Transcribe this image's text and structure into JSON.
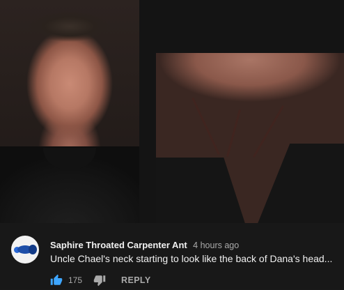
{
  "comment": {
    "author": "Saphire Throated Carpenter Ant",
    "time": "4 hours ago",
    "text": "Uncle Chael's neck starting to look like the back of Dana's head...",
    "like_count": "175",
    "reply_label": "REPLY",
    "avatar_icon": "ant-avatar-icon",
    "like_icon": "thumbs-up-icon",
    "dislike_icon": "thumbs-down-icon"
  },
  "colors": {
    "background": "#181818",
    "primary_text": "#f1f1f1",
    "secondary_text": "#aaaaaa",
    "like_active": "#3ea6ff"
  }
}
